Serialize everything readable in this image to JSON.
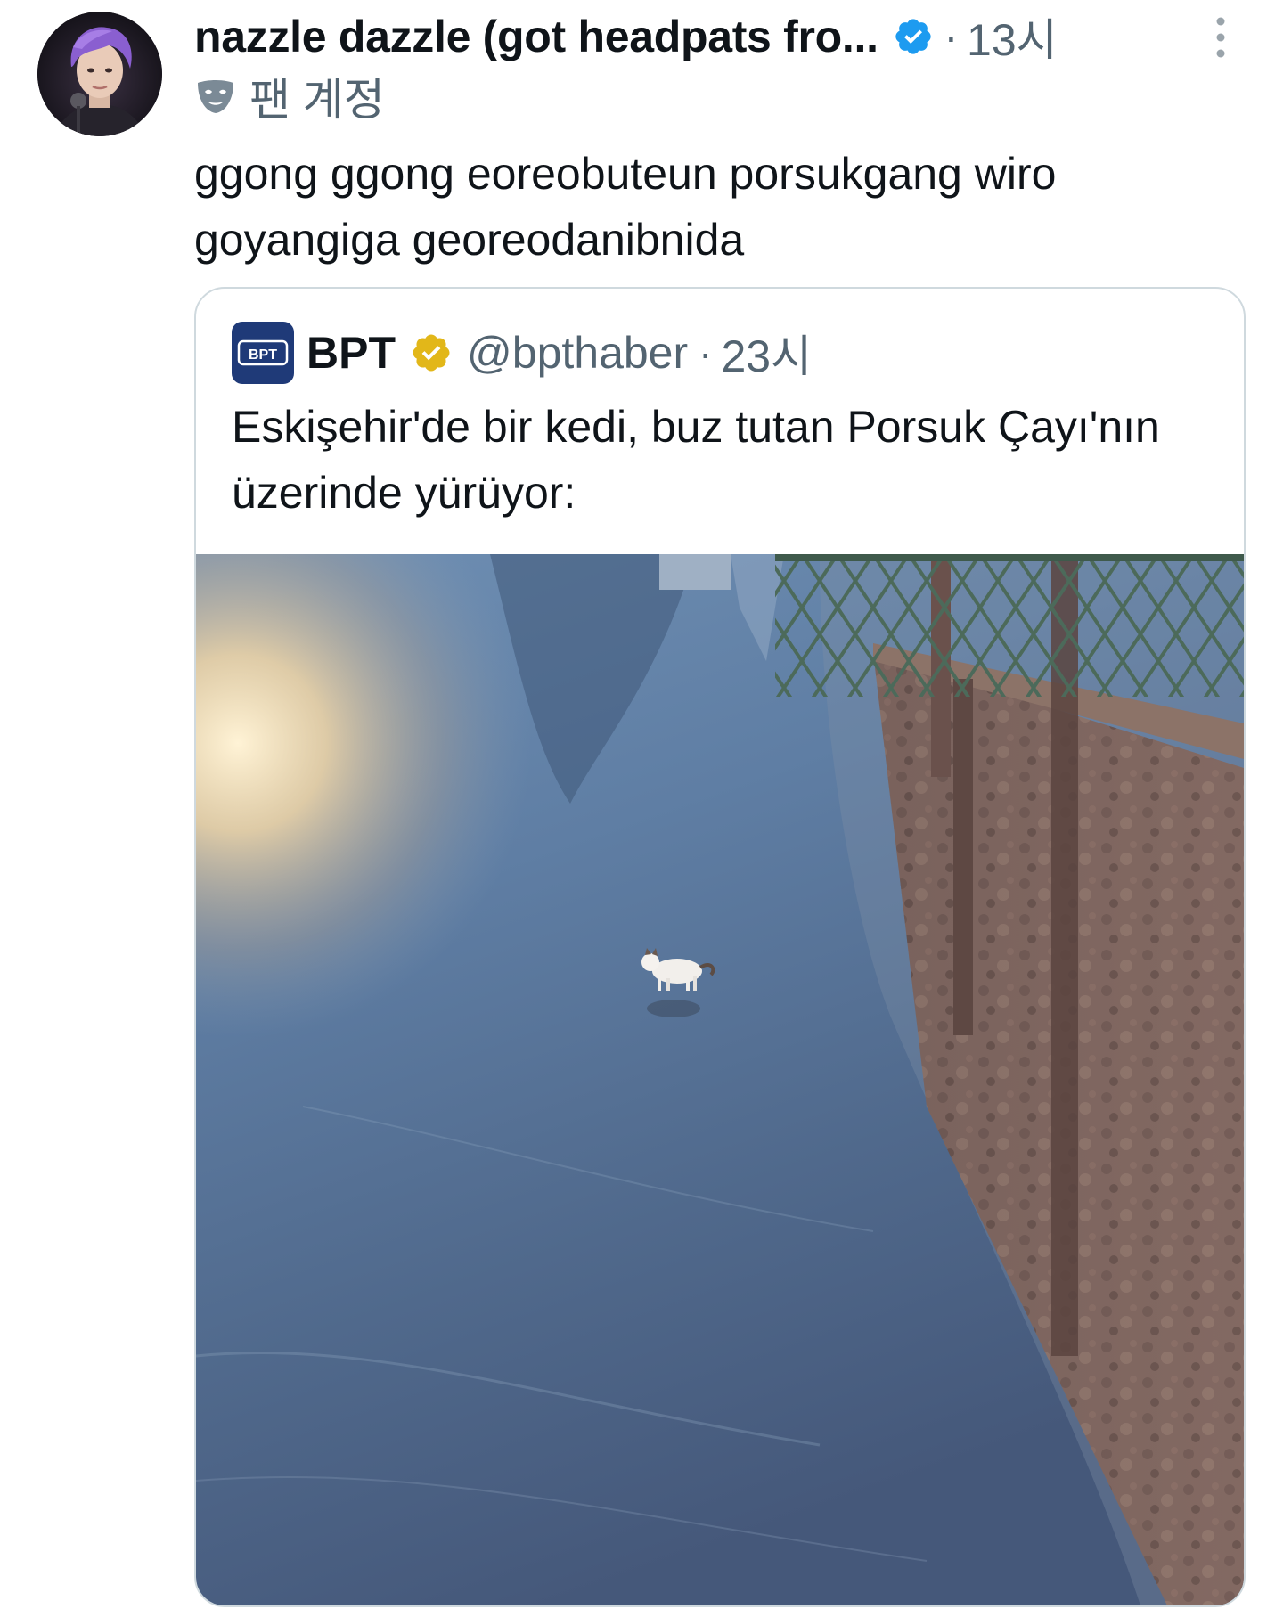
{
  "post": {
    "author": {
      "display_name": "nazzle dazzle (got headpats fro...",
      "verified": true,
      "verified_color": "#1d9bf0",
      "avatar_icon": "avatar"
    },
    "separator": "·",
    "time": "13시",
    "label": {
      "icon": "mask-icon",
      "text": "팬 계정"
    },
    "text": "ggong ggong eoreobuteun porsukgang wiro goyangiga georeodanibnida"
  },
  "quoted_post": {
    "author": {
      "logo_text": "BPT",
      "display_name": "BPT",
      "verified": true,
      "verified_color": "#e2b719",
      "handle": "@bpthaber"
    },
    "separator": "·",
    "time": "23시",
    "text": "Eskişehir'de bir kedi, buz tutan Porsuk Çayı'nın üzerinde yürüyor:",
    "media": {
      "type": "photo"
    }
  },
  "colors": {
    "text_primary": "#0f1419",
    "text_secondary": "#536471",
    "border": "#cfd9de",
    "logo_bg": "#1f3a78"
  }
}
